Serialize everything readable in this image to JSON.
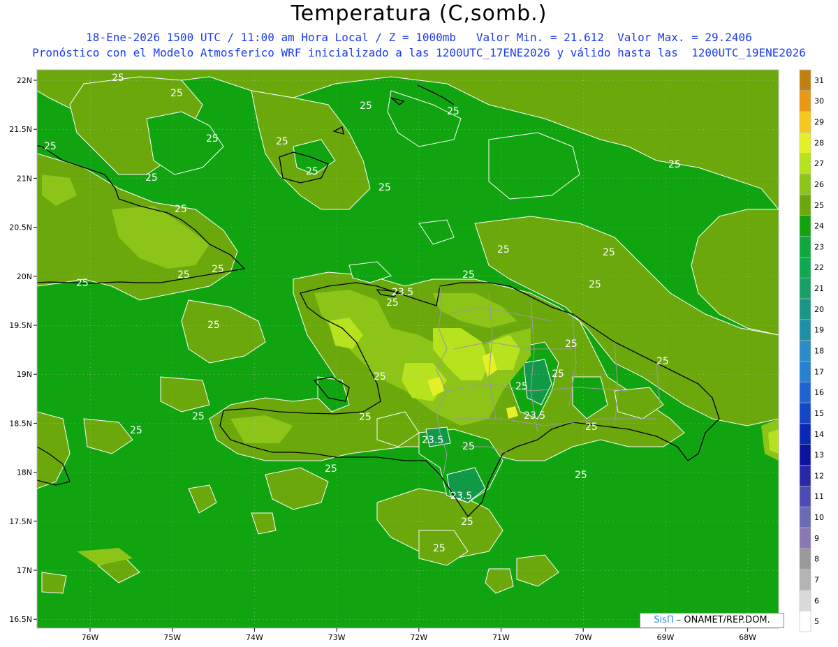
{
  "header": {
    "title": "Temperatura (C,somb.)",
    "subtitle1": "18-Ene-2026 1500 UTC / 11:00 am Hora Local / Z = 1000mb   Valor Min. = 21.612  Valor Max. = 29.2406",
    "subtitle2": "Pronóstico con el Modelo Atmosferico WRF inicializado a las 1200UTC_17ENE2026 y válido hasta las  1200UTC_19ENE2026"
  },
  "map": {
    "lat_ticks": [
      "22N",
      "21.5N",
      "21N",
      "20.5N",
      "20N",
      "19.5N",
      "19N",
      "18.5N",
      "18N",
      "17.5N",
      "17N",
      "16.5N"
    ],
    "lon_ticks": [
      "76W",
      "75W",
      "74W",
      "73W",
      "72W",
      "71W",
      "70W",
      "69W",
      "68W"
    ],
    "contour_labels": [
      "25",
      "25",
      "25",
      "25",
      "25",
      "25",
      "25",
      "25",
      "25",
      "25",
      "25",
      "25",
      "25",
      "25",
      "25",
      "25",
      "25",
      "25",
      "25",
      "25",
      "25",
      "25",
      "25",
      "25",
      "25",
      "25",
      "25",
      "25",
      "23.5",
      "23.5",
      "23.5",
      "23.5"
    ],
    "colors": {
      "sea_24": "#11a411",
      "t25": "#6aa80c",
      "t26": "#8cc418",
      "t27": "#b6e21e",
      "t28": "#e4f02a",
      "t23": "#109a48",
      "coast": "#000000",
      "province": "#9a9a9a",
      "contour": "#ffffff"
    }
  },
  "colorbar": {
    "levels": [
      "5",
      "6",
      "7",
      "8",
      "9",
      "10",
      "11",
      "12",
      "13",
      "14",
      "15",
      "16",
      "17",
      "18",
      "19",
      "20",
      "21",
      "22",
      "23",
      "24",
      "25",
      "26",
      "27",
      "28",
      "29",
      "30",
      "31"
    ],
    "colors": [
      "#ffffff",
      "#dadada",
      "#b4b4b4",
      "#9a9a9a",
      "#8a78b4",
      "#6a6ab6",
      "#4c4cb4",
      "#2828a6",
      "#0a14a0",
      "#0a28b8",
      "#1446c8",
      "#1e64d2",
      "#2880d2",
      "#2a8cc8",
      "#1e90a6",
      "#1a9684",
      "#16a068",
      "#10a850",
      "#0fa83a",
      "#11a411",
      "#6aa80c",
      "#8cc418",
      "#b6e21e",
      "#e4f02a",
      "#f4c81e",
      "#e89814",
      "#c08010"
    ]
  },
  "credit": {
    "brand": "SisΠ",
    "text": " – ONAMET/REP.DOM."
  }
}
